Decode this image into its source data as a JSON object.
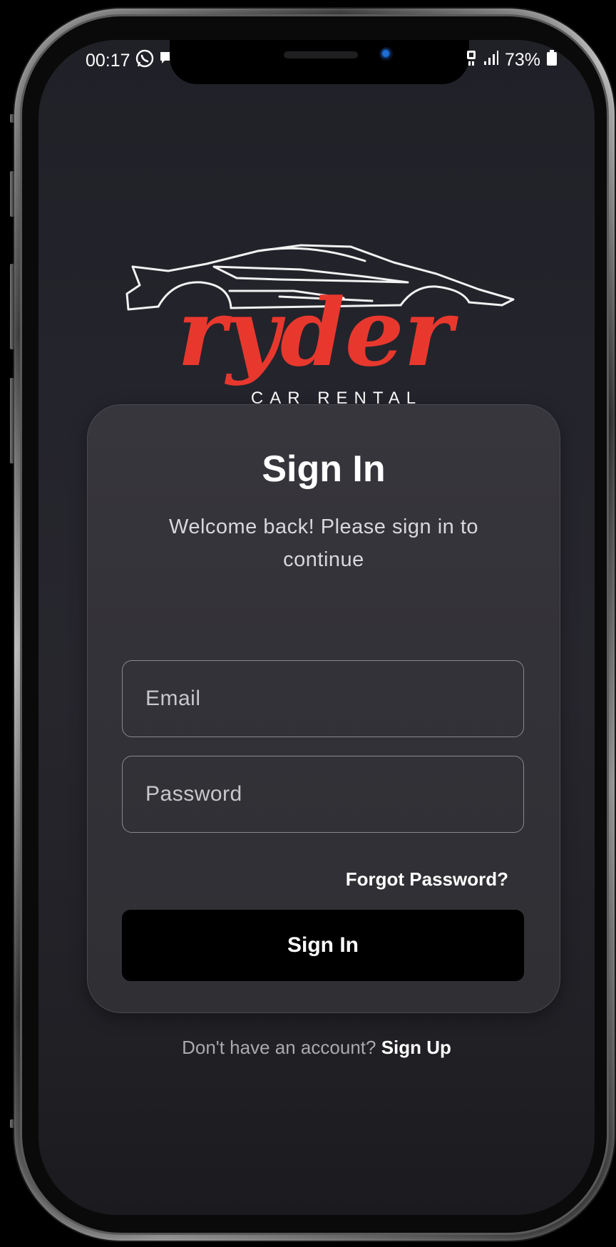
{
  "status_bar": {
    "time": "00:17",
    "battery": "73%",
    "icons": [
      "whatsapp-icon",
      "message-icon",
      "data-icon",
      "signal-icon",
      "battery-icon"
    ]
  },
  "logo": {
    "brand_name": "ryder",
    "tagline": "CAR RENTAL",
    "brand_color": "#e8382e"
  },
  "sign_in_card": {
    "title": "Sign In",
    "subtitle": "Welcome back! Please sign in to continue",
    "email": {
      "placeholder": "Email",
      "value": ""
    },
    "password": {
      "placeholder": "Password",
      "value": ""
    },
    "forgot_password": "Forgot Password?",
    "submit_label": "Sign In"
  },
  "footer": {
    "prompt": "Don't have an account?",
    "link": "Sign Up"
  },
  "colors": {
    "background": "#222229",
    "card": "#353439",
    "button": "#000000",
    "accent": "#e8382e"
  }
}
